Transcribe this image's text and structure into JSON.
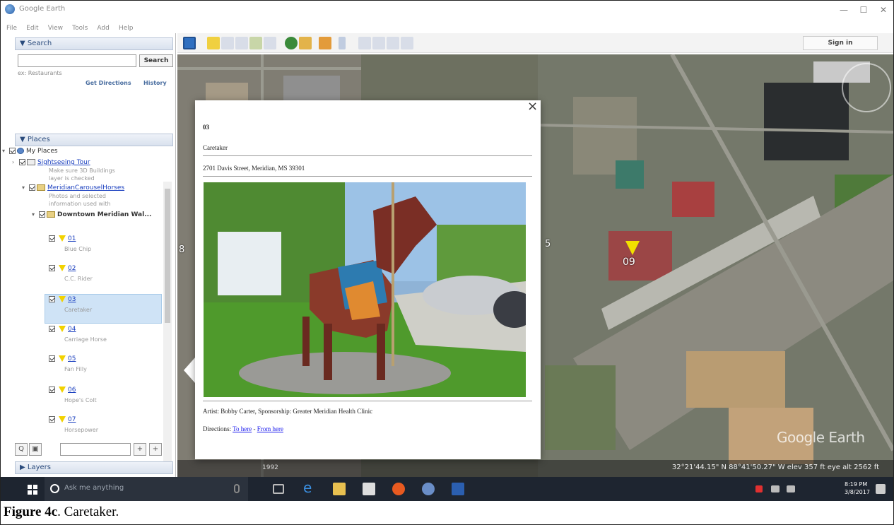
{
  "window": {
    "title": "Google Earth",
    "controls": [
      "—",
      "☐",
      "✕"
    ]
  },
  "menu": [
    "File",
    "Edit",
    "View",
    "Tools",
    "Add",
    "Help"
  ],
  "toolbar": {
    "sign_in": "Sign in"
  },
  "search_panel": {
    "header": "▼ Search",
    "search_button": "Search",
    "input_value": "",
    "hint": "ex: Restaurants",
    "get_directions": "Get Directions",
    "history": "History"
  },
  "places_panel": {
    "header": "▼ Places",
    "my_places": "My Places",
    "sightseeing_tour": "Sightseeing Tour",
    "sightseeing_desc1": "Make sure 3D Buildings",
    "sightseeing_desc2": "layer is checked",
    "meridian_folder": "MeridianCarouselHorses",
    "meridian_desc1": "Photos and selected",
    "meridian_desc2": "information used with",
    "downtown_folder": "Downtown Meridian Wal...",
    "items": [
      {
        "num": "01",
        "name": "Blue Chip"
      },
      {
        "num": "02",
        "name": "C.C. Rider"
      },
      {
        "num": "03",
        "name": "Caretaker"
      },
      {
        "num": "04",
        "name": "Carriage Horse"
      },
      {
        "num": "05",
        "name": "Fan Filly"
      },
      {
        "num": "06",
        "name": "Hope's Colt"
      },
      {
        "num": "07",
        "name": "Horsepower"
      }
    ],
    "tools": [
      "Q",
      "▣",
      "+",
      "+"
    ]
  },
  "layers_panel": {
    "header": "▶ Layers"
  },
  "map": {
    "placemark_label": "09",
    "side_label_left": "8",
    "side_label_mid": "5",
    "watermark": "Google Earth",
    "imagery_date": "1992",
    "status": "32°21'44.15\" N 88°41'50.27\" W elev 357 ft eye alt 2562 ft"
  },
  "popup": {
    "close": "×",
    "number": "03",
    "name": "Caretaker",
    "address": "2701 Davis Street, Meridian, MS 39301",
    "credits": "Artist: Bobby Carter, Sponsorship: Greater Meridian Health Clinic",
    "directions_label": "Directions:",
    "to_here": "To here",
    "separator": " - ",
    "from_here": "From here"
  },
  "taskbar": {
    "search_placeholder": "Ask me anything",
    "time": "8:19 PM",
    "date": "3/8/2017"
  },
  "caption": {
    "label": "Figure 4c",
    "text": ".  Caretaker."
  },
  "colors": {
    "accent": "#2a4b7c",
    "link": "#1a3fbf",
    "pin_yellow": "#f2d200",
    "taskbar": "#1e2530"
  }
}
